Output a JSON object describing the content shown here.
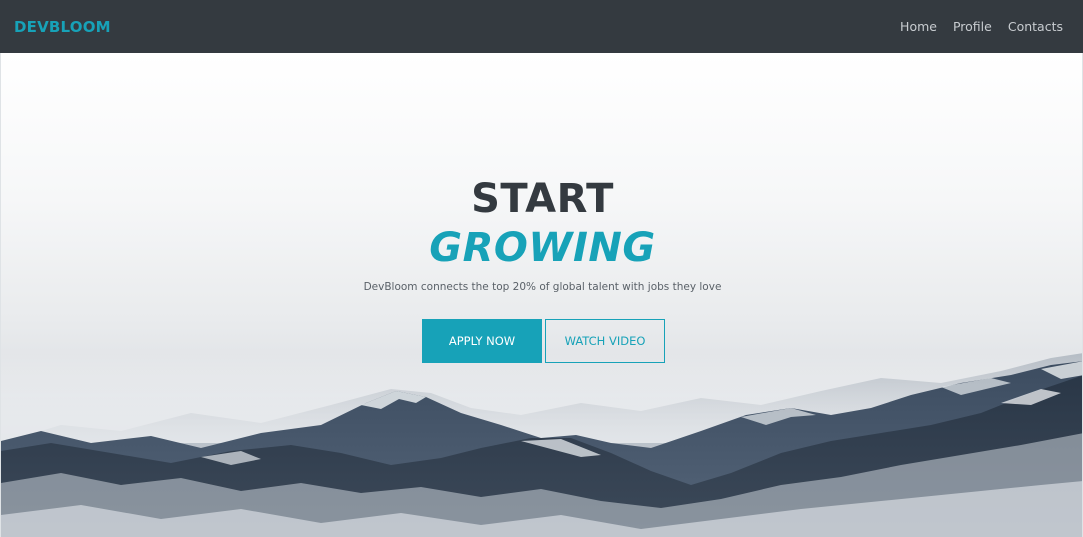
{
  "navbar": {
    "brand": "DEVBLOOM",
    "links": [
      "Home",
      "Profile",
      "Contacts"
    ]
  },
  "hero": {
    "title_line1": "START",
    "title_line2": "GROWING",
    "subtitle": "DevBloom connects the top 20% of global talent with jobs they love",
    "primary_button": "APPLY NOW",
    "secondary_button": "WATCH VIDEO",
    "background": "snowy-mountain-landscape-photo"
  },
  "colors": {
    "accent": "#17a2b8",
    "navbar": "#343a40",
    "title_dark": "#343a40"
  }
}
